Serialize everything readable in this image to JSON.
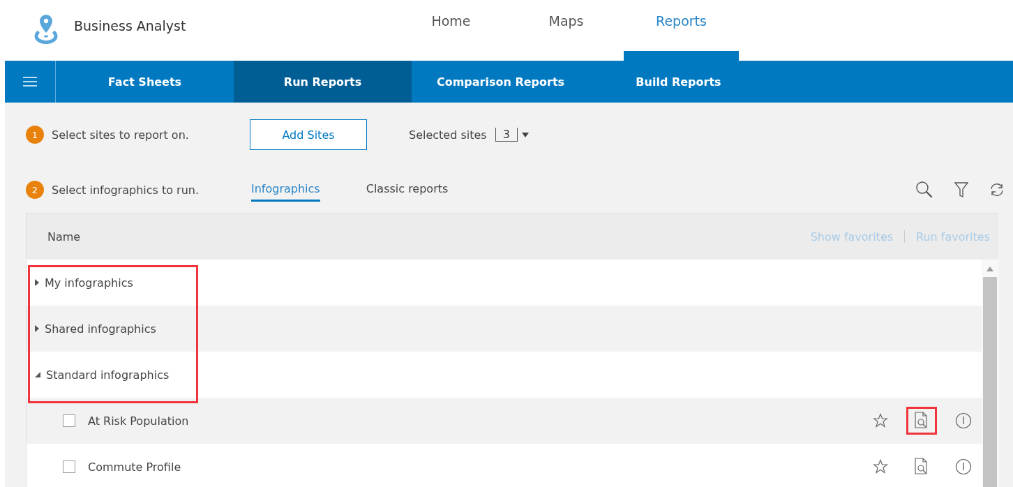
{
  "app": {
    "title": "Business Analyst"
  },
  "nav": [
    {
      "label": "Home",
      "selected": false
    },
    {
      "label": "Maps",
      "selected": false
    },
    {
      "label": "Reports",
      "selected": true
    }
  ],
  "subnav": [
    {
      "label": "Fact Sheets",
      "selected": false
    },
    {
      "label": "Run Reports",
      "selected": true
    },
    {
      "label": "Comparison Reports",
      "selected": false
    },
    {
      "label": "Build Reports",
      "selected": false
    }
  ],
  "step1": {
    "number": "1",
    "text": "Select sites to report on.",
    "button": "Add Sites",
    "selected_label": "Selected sites",
    "selected_count": "3"
  },
  "step2": {
    "number": "2",
    "text": "Select infographics to run.",
    "tabs": [
      {
        "label": "Infographics",
        "selected": true
      },
      {
        "label": "Classic reports",
        "selected": false
      }
    ]
  },
  "table": {
    "column": "Name",
    "show_favorites": "Show favorites",
    "run_favorites": "Run favorites",
    "groups_highlighted": true,
    "groups": [
      {
        "label": "My infographics",
        "expanded": false
      },
      {
        "label": "Shared infographics",
        "expanded": false
      },
      {
        "label": "Standard infographics",
        "expanded": true,
        "children": [
          {
            "label": "At Risk Population",
            "checked": false,
            "favorite": false,
            "preview_highlighted": true
          },
          {
            "label": "Commute Profile",
            "checked": false,
            "favorite": false,
            "preview_highlighted": false
          }
        ]
      }
    ]
  }
}
